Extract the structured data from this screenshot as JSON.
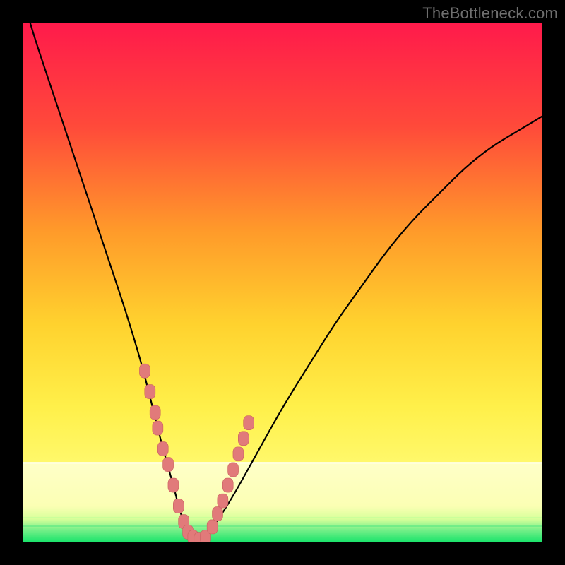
{
  "watermark": "TheBottleneck.com",
  "colors": {
    "frame": "#000000",
    "grad_top": "#ff1a4b",
    "grad_mid1": "#ff6a2e",
    "grad_mid2": "#ffd22e",
    "grad_mid3": "#fff55a",
    "grad_band_pale": "#ffffb0",
    "grad_green": "#17e36a",
    "curve": "#000000",
    "marker_fill": "#e17a7a",
    "marker_stroke": "#c95e5e"
  },
  "chart_data": {
    "type": "line",
    "title": "",
    "xlabel": "",
    "ylabel": "",
    "xlim": [
      0,
      100
    ],
    "ylim": [
      0,
      100
    ],
    "series": [
      {
        "name": "bottleneck-curve",
        "x": [
          0,
          2,
          5,
          8,
          11,
          14,
          17,
          20,
          23,
          25,
          27,
          29,
          30.5,
          32,
          33,
          34,
          36,
          40,
          45,
          50,
          55,
          60,
          65,
          70,
          75,
          80,
          85,
          90,
          95,
          100
        ],
        "y": [
          105,
          98,
          89,
          80,
          71,
          62,
          53,
          44,
          34,
          26,
          18,
          11,
          5,
          2,
          0.5,
          0.5,
          2,
          8,
          17,
          26,
          34,
          42,
          49,
          56,
          62,
          67,
          72,
          76,
          79,
          82
        ]
      }
    ],
    "markers": {
      "name": "highlighted-range",
      "x": [
        23.5,
        24.5,
        25.5,
        26,
        27,
        28,
        29,
        30,
        31,
        31.8,
        32.8,
        34,
        35.2,
        36.5,
        37.5,
        38.5,
        39.5,
        40.5,
        41.5,
        42.5,
        43.5
      ],
      "y": [
        33,
        29,
        25,
        22,
        18,
        15,
        11,
        7,
        4,
        2,
        1,
        0.6,
        1,
        3,
        5.5,
        8,
        11,
        14,
        17,
        20,
        23
      ]
    }
  }
}
